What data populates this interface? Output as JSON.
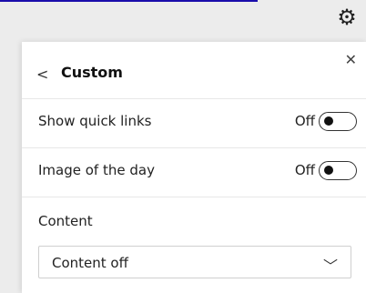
{
  "panel": {
    "title": "Custom",
    "back_icon": "chevron-left-icon",
    "close_icon": "close-icon"
  },
  "toggles": [
    {
      "label": "Show quick links",
      "state_text": "Off"
    },
    {
      "label": "Image of the day",
      "state_text": "Off"
    }
  ],
  "content_section": {
    "label": "Content",
    "selected_value": "Content off",
    "dropdown_icon": "chevron-down-icon"
  },
  "gear_icon": "gear-icon",
  "colors": {
    "panel_bg": "#ffffff",
    "page_bg": "#ececec",
    "link_blue": "#1a0dab"
  }
}
